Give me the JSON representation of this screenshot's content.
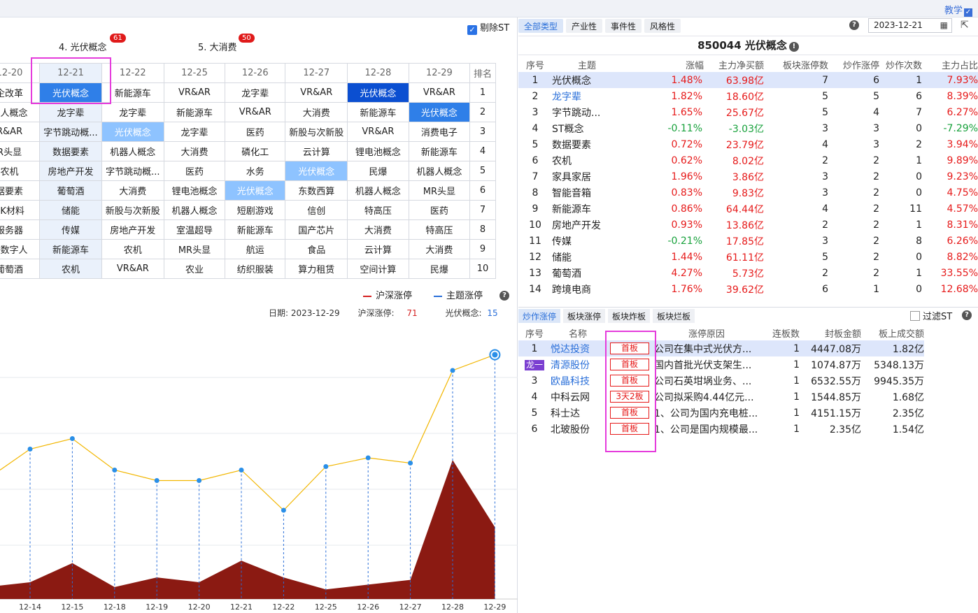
{
  "topbar": {
    "teach_label": "教学",
    "teach_check": "✓"
  },
  "left": {
    "exclude_st_label": "剔除ST",
    "exclude_st_check": "✓",
    "theme_tabs": [
      {
        "label": "4. 光伏概念",
        "badge": "61"
      },
      {
        "label": "5. 大消费",
        "badge": "50"
      }
    ],
    "grid": {
      "dates": [
        "12-20",
        "12-21",
        "12-22",
        "12-25",
        "12-26",
        "12-27",
        "12-28",
        "12-29"
      ],
      "rank_header": "排名",
      "rows": [
        {
          "rank": "1",
          "cells": [
            "企改革",
            "光伏概念",
            "新能源车",
            "VR&AR",
            "龙字辈",
            "VR&AR",
            "光伏概念",
            "VR&AR"
          ]
        },
        {
          "rank": "2",
          "cells": [
            "器人概念",
            "龙字辈",
            "龙字辈",
            "新能源车",
            "VR&AR",
            "大消费",
            "新能源车",
            "光伏概念"
          ]
        },
        {
          "rank": "3",
          "cells": [
            "R&AR",
            "字节跳动概...",
            "光伏概念",
            "龙字辈",
            "医药",
            "新股与次新股",
            "VR&AR",
            "消费电子"
          ]
        },
        {
          "rank": "4",
          "cells": [
            "R头显",
            "数据要素",
            "机器人概念",
            "大消费",
            "磷化工",
            "云计算",
            "锂电池概念",
            "新能源车"
          ]
        },
        {
          "rank": "5",
          "cells": [
            "农机",
            "房地产开发",
            "字节跳动概...",
            "医药",
            "水务",
            "光伏概念",
            "民爆",
            "机器人概念"
          ]
        },
        {
          "rank": "6",
          "cells": [
            "据要素",
            "葡萄酒",
            "大消费",
            "锂电池概念",
            "光伏概念",
            "东数西算",
            "机器人概念",
            "MR头显"
          ]
        },
        {
          "rank": "7",
          "cells": [
            "EK材料",
            "储能",
            "新股与次新股",
            "机器人概念",
            "短剧游戏",
            "信创",
            "特高压",
            "医药"
          ]
        },
        {
          "rank": "8",
          "cells": [
            "服务器",
            "传媒",
            "房地产开发",
            "室温超导",
            "新能源车",
            "国产芯片",
            "大消费",
            "特高压"
          ]
        },
        {
          "rank": "9",
          "cells": [
            "以数字人",
            "新能源车",
            "农机",
            "MR头显",
            "航运",
            "食品",
            "云计算",
            "大消费"
          ]
        },
        {
          "rank": "10",
          "cells": [
            "葡萄酒",
            "农机",
            "VR&AR",
            "农业",
            "纺织服装",
            "算力租赁",
            "空间计算",
            "民爆"
          ]
        }
      ]
    },
    "legend": {
      "a": "沪深涨停",
      "b": "主题涨停",
      "a_color": "#d42020",
      "b_color": "#2a6fd9"
    },
    "info": {
      "date_label": "日期:",
      "date": "2023-12-29",
      "hs_label": "沪深涨停:",
      "hs_value": "71",
      "theme_label": "光伏概念:",
      "theme_value": "15"
    },
    "chart_data": {
      "type": "line",
      "x": [
        "12-14",
        "12-15",
        "12-18",
        "12-19",
        "12-20",
        "12-21",
        "12-22",
        "12-25",
        "12-26",
        "12-27",
        "12-28",
        "12-29"
      ],
      "series": [
        {
          "name": "沪深涨停",
          "type": "area",
          "color": "#8b1a12",
          "values": [
            7,
            15,
            5,
            9,
            7,
            16,
            9,
            4,
            6,
            8,
            58,
            30
          ]
        },
        {
          "name": "主题涨停",
          "type": "line",
          "color": "#f2b600",
          "values": [
            2,
            2.6,
            0.8,
            0.2,
            0.2,
            0.8,
            -1.5,
            1,
            1.5,
            1.2,
            6.5,
            7.4
          ]
        }
      ]
    }
  },
  "right": {
    "tabs": [
      "全部类型",
      "产业性",
      "事件性",
      "风格性"
    ],
    "date": "2023-12-21",
    "cal_icon": "▦",
    "share_icon": "⇱",
    "help": "?",
    "title": "850044 光伏概念",
    "title_icon": "!",
    "columns": [
      "序号",
      "主题",
      "涨幅",
      "主力净买额",
      "板块涨停数",
      "炒作涨停",
      "炒作次数",
      "主力占比"
    ],
    "rows": [
      {
        "no": "1",
        "name": "光伏概念",
        "chg": "1.48%",
        "net": "63.98亿",
        "limit": "7",
        "hot": "6",
        "times": "1",
        "ratio": "7.93%",
        "sel": true,
        "link": false,
        "dir": "up"
      },
      {
        "no": "2",
        "name": "龙字辈",
        "chg": "1.82%",
        "net": "18.60亿",
        "limit": "5",
        "hot": "5",
        "times": "6",
        "ratio": "8.39%",
        "sel": false,
        "link": true,
        "dir": "up"
      },
      {
        "no": "3",
        "name": "字节跳动...",
        "chg": "1.65%",
        "net": "25.67亿",
        "limit": "5",
        "hot": "4",
        "times": "7",
        "ratio": "6.27%",
        "sel": false,
        "link": false,
        "dir": "up"
      },
      {
        "no": "4",
        "name": "ST概念",
        "chg": "-0.11%",
        "net": "-3.03亿",
        "limit": "3",
        "hot": "3",
        "times": "0",
        "ratio": "-7.29%",
        "sel": false,
        "link": false,
        "dir": "down"
      },
      {
        "no": "5",
        "name": "数据要素",
        "chg": "0.72%",
        "net": "23.79亿",
        "limit": "4",
        "hot": "3",
        "times": "2",
        "ratio": "3.94%",
        "sel": false,
        "link": false,
        "dir": "up"
      },
      {
        "no": "6",
        "name": "农机",
        "chg": "0.62%",
        "net": "8.02亿",
        "limit": "2",
        "hot": "2",
        "times": "1",
        "ratio": "9.89%",
        "sel": false,
        "link": false,
        "dir": "up"
      },
      {
        "no": "7",
        "name": "家具家居",
        "chg": "1.96%",
        "net": "3.86亿",
        "limit": "3",
        "hot": "2",
        "times": "0",
        "ratio": "9.23%",
        "sel": false,
        "link": false,
        "dir": "up"
      },
      {
        "no": "8",
        "name": "智能音箱",
        "chg": "0.83%",
        "net": "9.83亿",
        "limit": "3",
        "hot": "2",
        "times": "0",
        "ratio": "4.75%",
        "sel": false,
        "link": false,
        "dir": "up"
      },
      {
        "no": "9",
        "name": "新能源车",
        "chg": "0.86%",
        "net": "64.44亿",
        "limit": "4",
        "hot": "2",
        "times": "11",
        "ratio": "4.57%",
        "sel": false,
        "link": false,
        "dir": "up"
      },
      {
        "no": "10",
        "name": "房地产开发",
        "chg": "0.93%",
        "net": "13.86亿",
        "limit": "2",
        "hot": "2",
        "times": "1",
        "ratio": "8.31%",
        "sel": false,
        "link": false,
        "dir": "up"
      },
      {
        "no": "11",
        "name": "传媒",
        "chg": "-0.21%",
        "net": "17.85亿",
        "limit": "3",
        "hot": "2",
        "times": "8",
        "ratio": "6.26%",
        "sel": false,
        "link": false,
        "dir": "mixed"
      },
      {
        "no": "12",
        "name": "储能",
        "chg": "1.44%",
        "net": "61.11亿",
        "limit": "5",
        "hot": "2",
        "times": "0",
        "ratio": "8.82%",
        "sel": false,
        "link": false,
        "dir": "up"
      },
      {
        "no": "13",
        "name": "葡萄酒",
        "chg": "4.27%",
        "net": "5.73亿",
        "limit": "2",
        "hot": "2",
        "times": "1",
        "ratio": "33.55%",
        "sel": false,
        "link": false,
        "dir": "up"
      },
      {
        "no": "14",
        "name": "跨境电商",
        "chg": "1.76%",
        "net": "39.62亿",
        "limit": "6",
        "hot": "1",
        "times": "0",
        "ratio": "12.68%",
        "sel": false,
        "link": false,
        "dir": "up"
      }
    ],
    "tabs2": [
      "炒作涨停",
      "板块涨停",
      "板块炸板",
      "板块烂板"
    ],
    "filter_st_label": "过滤ST",
    "stock_columns": [
      "序号",
      "名称",
      "",
      "涨停原因",
      "连板数",
      "封板金额",
      "板上成交额"
    ],
    "stocks": [
      {
        "no": "1",
        "dragon": "",
        "name": "悦达投资",
        "tag": "首板",
        "reason": "公司在集中式光伏方...",
        "boards": "1",
        "seal": "4447.08万",
        "turnover": "1.82亿",
        "sel": true,
        "link": true
      },
      {
        "no": "",
        "dragon": "龙一",
        "name": "清源股份",
        "tag": "首板",
        "reason": "国内首批光伏支架生...",
        "boards": "1",
        "seal": "1074.87万",
        "turnover": "5348.13万",
        "sel": false,
        "link": true
      },
      {
        "no": "3",
        "dragon": "",
        "name": "欧晶科技",
        "tag": "首板",
        "reason": "公司石英坩埚业务、...",
        "boards": "1",
        "seal": "6532.55万",
        "turnover": "9945.35万",
        "sel": false,
        "link": true
      },
      {
        "no": "4",
        "dragon": "",
        "name": "中科云网",
        "tag": "3天2板",
        "reason": "公司拟采购4.44亿元...",
        "boards": "1",
        "seal": "1544.85万",
        "turnover": "1.68亿",
        "sel": false,
        "link": false
      },
      {
        "no": "5",
        "dragon": "",
        "name": "科士达",
        "tag": "首板",
        "reason": "1、公司为国内充电桩...",
        "boards": "1",
        "seal": "4151.15万",
        "turnover": "2.35亿",
        "sel": false,
        "link": false
      },
      {
        "no": "6",
        "dragon": "",
        "name": "北玻股份",
        "tag": "首板",
        "reason": "1、公司是国内规模最...",
        "boards": "1",
        "seal": "2.35亿",
        "turnover": "1.54亿",
        "sel": false,
        "link": false
      }
    ]
  }
}
